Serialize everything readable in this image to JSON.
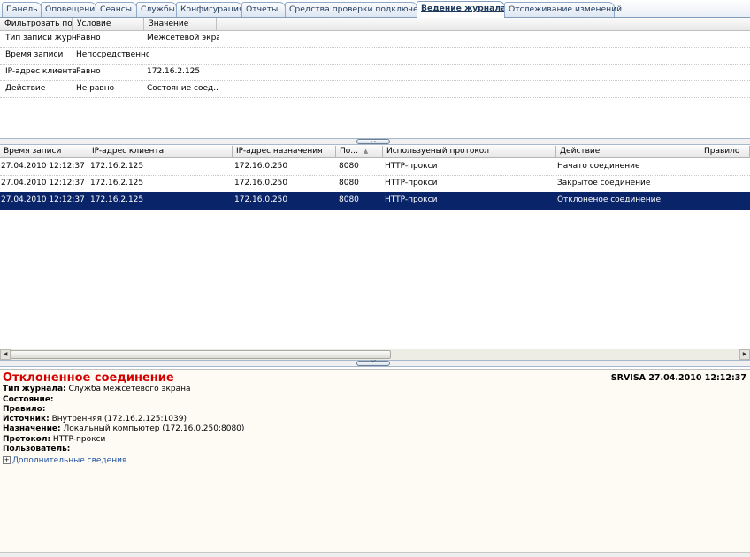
{
  "tabs": [
    {
      "label": "Панель"
    },
    {
      "label": "Оповещения"
    },
    {
      "label": "Сеансы"
    },
    {
      "label": "Службы"
    },
    {
      "label": "Конфигурация"
    },
    {
      "label": "Отчеты"
    },
    {
      "label": "Средства проверки подключения"
    },
    {
      "label": "Ведение журнала",
      "active": true
    },
    {
      "label": "Отслеживание изменений"
    }
  ],
  "filter": {
    "headers": [
      "Фильтровать по",
      "Условие",
      "Значение"
    ],
    "rows": [
      {
        "field": "Тип записи журн...",
        "condition": "Равно",
        "value": "Межсетевой экра..."
      },
      {
        "field": "Время записи",
        "condition": "Непосредственное",
        "value": ""
      },
      {
        "field": "IP-адрес клиента",
        "condition": "Равно",
        "value": "172.16.2.125"
      },
      {
        "field": "Действие",
        "condition": "Не равно",
        "value": "Состояние соед..."
      }
    ]
  },
  "log": {
    "headers": [
      "Время записи",
      "IP-адрес клиента",
      "IP-адрес назначения",
      "По...",
      "Используеный протокол",
      "Действие",
      "Правило"
    ],
    "sort_indicator": "▲",
    "rows": [
      {
        "time": "27.04.2010 12:12:37",
        "client": "172.16.2.125",
        "dest": "172.16.0.250",
        "port": "8080",
        "protocol": "HTTP-прокси",
        "action": "Начато соединение",
        "rule": ""
      },
      {
        "time": "27.04.2010 12:12:37",
        "client": "172.16.2.125",
        "dest": "172.16.0.250",
        "port": "8080",
        "protocol": "HTTP-прокси",
        "action": "Закрытое соединение",
        "rule": ""
      },
      {
        "time": "27.04.2010 12:12:37",
        "client": "172.16.2.125",
        "dest": "172.16.0.250",
        "port": "8080",
        "protocol": "HTTP-прокси",
        "action": "Отклоненое соединение",
        "rule": "",
        "selected": true
      }
    ]
  },
  "details": {
    "title": "Отклоненное соединение",
    "server_time": "SRVISA 27.04.2010 12:12:37",
    "fields": [
      {
        "label": "Тип журнала:",
        "value": "Служба межсетевого экрана"
      },
      {
        "label": "Состояние:",
        "value": ""
      },
      {
        "label": "Правило:",
        "value": ""
      },
      {
        "label": "Источник:",
        "value": "Внутренняя (172.16.2.125:1039)"
      },
      {
        "label": "Назначение:",
        "value": "Локальный компьютер (172.16.0.250:8080)"
      },
      {
        "label": "Протокол:",
        "value": "HTTP-прокси"
      },
      {
        "label": "Пользователь:",
        "value": ""
      }
    ],
    "more_label": "Дополнительные сведения",
    "more_expander": "+"
  },
  "splitters": {
    "collapse_glyph": "︿",
    "expand_glyph": "﹀"
  },
  "scrollbar": {
    "left_glyph": "◀",
    "right_glyph": "▶"
  },
  "colors": {
    "selection": "#0a246a",
    "title_red": "#d40000",
    "link_blue": "#1e4f9e",
    "details_bg": "#fdfbf4"
  }
}
